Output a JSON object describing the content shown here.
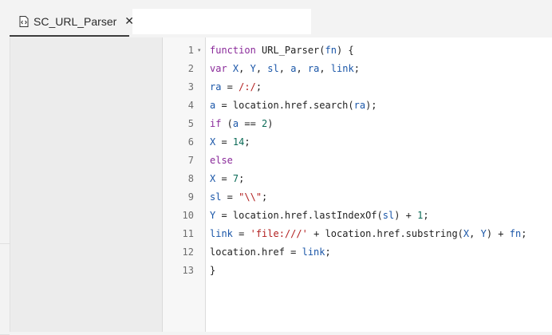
{
  "tab": {
    "title": "SC_URL_Parser",
    "close_glyph": "✕",
    "icon": "code-file-icon"
  },
  "editor": {
    "lines": [
      {
        "number": "1",
        "folded_marker": "▾",
        "tokens": [
          {
            "t": "function",
            "c": "kw"
          },
          {
            "t": " URL_Parser(",
            "c": "pl"
          },
          {
            "t": "fn",
            "c": "vr"
          },
          {
            "t": ") {",
            "c": "pl"
          }
        ]
      },
      {
        "number": "2",
        "tokens": [
          {
            "t": "var",
            "c": "kw"
          },
          {
            "t": " ",
            "c": "pl"
          },
          {
            "t": "X",
            "c": "vr"
          },
          {
            "t": ", ",
            "c": "pl"
          },
          {
            "t": "Y",
            "c": "vr"
          },
          {
            "t": ", ",
            "c": "pl"
          },
          {
            "t": "sl",
            "c": "vr"
          },
          {
            "t": ", ",
            "c": "pl"
          },
          {
            "t": "a",
            "c": "vr"
          },
          {
            "t": ", ",
            "c": "pl"
          },
          {
            "t": "ra",
            "c": "vr"
          },
          {
            "t": ", ",
            "c": "pl"
          },
          {
            "t": "link",
            "c": "vr"
          },
          {
            "t": ";",
            "c": "pl"
          }
        ]
      },
      {
        "number": "3",
        "tokens": [
          {
            "t": "ra",
            "c": "vr"
          },
          {
            "t": " = ",
            "c": "pl"
          },
          {
            "t": "/:/",
            "c": "st"
          },
          {
            "t": ";",
            "c": "pl"
          }
        ]
      },
      {
        "number": "4",
        "tokens": [
          {
            "t": "a",
            "c": "vr"
          },
          {
            "t": " = location.href.search(",
            "c": "pl"
          },
          {
            "t": "ra",
            "c": "vr"
          },
          {
            "t": ");",
            "c": "pl"
          }
        ]
      },
      {
        "number": "5",
        "tokens": [
          {
            "t": "if",
            "c": "kw"
          },
          {
            "t": " (",
            "c": "pl"
          },
          {
            "t": "a",
            "c": "vr"
          },
          {
            "t": " == ",
            "c": "pl"
          },
          {
            "t": "2",
            "c": "nm"
          },
          {
            "t": ")",
            "c": "pl"
          }
        ]
      },
      {
        "number": "6",
        "tokens": [
          {
            "t": "X",
            "c": "vr"
          },
          {
            "t": " = ",
            "c": "pl"
          },
          {
            "t": "14",
            "c": "nm"
          },
          {
            "t": ";",
            "c": "pl"
          }
        ]
      },
      {
        "number": "7",
        "tokens": [
          {
            "t": "else",
            "c": "kw"
          }
        ]
      },
      {
        "number": "8",
        "tokens": [
          {
            "t": "X",
            "c": "vr"
          },
          {
            "t": " = ",
            "c": "pl"
          },
          {
            "t": "7",
            "c": "nm"
          },
          {
            "t": ";",
            "c": "pl"
          }
        ]
      },
      {
        "number": "9",
        "tokens": [
          {
            "t": "sl",
            "c": "vr"
          },
          {
            "t": " = ",
            "c": "pl"
          },
          {
            "t": "\"\\\\\"",
            "c": "st"
          },
          {
            "t": ";",
            "c": "pl"
          }
        ]
      },
      {
        "number": "10",
        "tokens": [
          {
            "t": "Y",
            "c": "vr"
          },
          {
            "t": " = location.href.lastIndexOf(",
            "c": "pl"
          },
          {
            "t": "sl",
            "c": "vr"
          },
          {
            "t": ") + ",
            "c": "pl"
          },
          {
            "t": "1",
            "c": "nm"
          },
          {
            "t": ";",
            "c": "pl"
          }
        ]
      },
      {
        "number": "11",
        "tokens": [
          {
            "t": "link",
            "c": "vr"
          },
          {
            "t": " = ",
            "c": "pl"
          },
          {
            "t": "'file:///'",
            "c": "st"
          },
          {
            "t": " + location.href.substring(",
            "c": "pl"
          },
          {
            "t": "X",
            "c": "vr"
          },
          {
            "t": ", ",
            "c": "pl"
          },
          {
            "t": "Y",
            "c": "vr"
          },
          {
            "t": ") + ",
            "c": "pl"
          },
          {
            "t": "fn",
            "c": "vr"
          },
          {
            "t": ";",
            "c": "pl"
          }
        ]
      },
      {
        "number": "12",
        "tokens": [
          {
            "t": "location.href = ",
            "c": "pl"
          },
          {
            "t": "link",
            "c": "vr"
          },
          {
            "t": ";",
            "c": "pl"
          }
        ]
      },
      {
        "number": "13",
        "tokens": [
          {
            "t": "}",
            "c": "pl"
          }
        ]
      }
    ]
  },
  "colors": {
    "keyword": "#8a2a9a",
    "variable": "#1a56a8",
    "number": "#0b6b57",
    "string": "#b21e1e"
  }
}
